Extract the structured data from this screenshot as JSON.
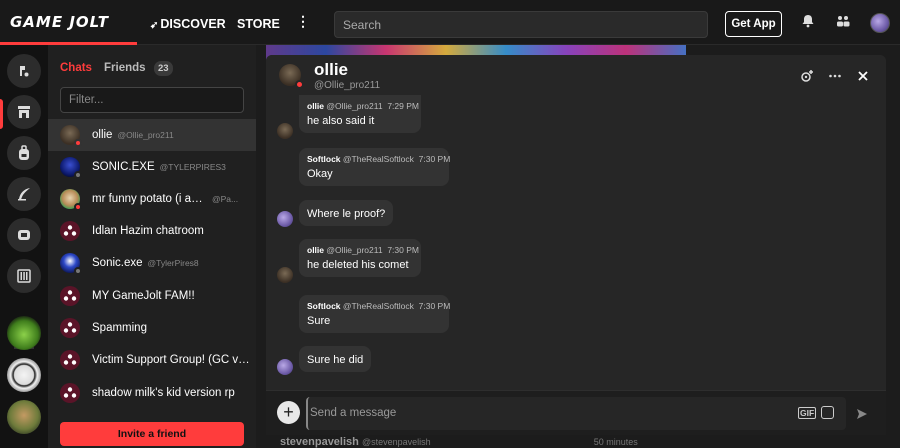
{
  "brand": {
    "name": "GAME JOLT",
    "accent": "#ff3c3c"
  },
  "nav": {
    "discover": "DISCOVER",
    "store": "STORE",
    "more": "more-icon"
  },
  "search": {
    "placeholder": "Search"
  },
  "header_actions": {
    "get_app": "Get App"
  },
  "sidebar_tabs": {
    "chats": "Chats",
    "friends": "Friends",
    "friend_count": "23"
  },
  "filter": {
    "placeholder": "Filter..."
  },
  "chats": [
    {
      "name": "ollie",
      "handle": "@Ollie_pro211"
    },
    {
      "name": "SONIC.EXE",
      "handle": "@TYLERPIRES3"
    },
    {
      "name": "mr funny potato (i am a f...",
      "handle": "@Pa..."
    },
    {
      "name": "Idlan Hazim chatroom",
      "handle": ""
    },
    {
      "name": "Sonic.exe",
      "handle": "@TylerPires8"
    },
    {
      "name": "MY GameJolt FAM!!",
      "handle": ""
    },
    {
      "name": "Spamming",
      "handle": ""
    },
    {
      "name": "Victim Support Group! (GC ver...",
      "handle": ""
    },
    {
      "name": "shadow milk's kid version rp",
      "handle": ""
    }
  ],
  "invite": {
    "label": "Invite a friend"
  },
  "room": {
    "name": "ollie",
    "handle": "@Ollie_pro211"
  },
  "messages": [
    {
      "user": "ollie",
      "handle": "@Ollie_pro211",
      "time": "7:29 PM",
      "text": "he also said it"
    },
    {
      "user": "Softlock",
      "handle": "@TheRealSoftlock",
      "time": "7:30 PM",
      "text": "Okay"
    },
    {
      "user": "",
      "handle": "",
      "time": "",
      "text": "Where le proof?"
    },
    {
      "user": "ollie",
      "handle": "@Ollie_pro211",
      "time": "7:30 PM",
      "text": "he deleted his comet"
    },
    {
      "user": "Softlock",
      "handle": "@TheRealSoftlock",
      "time": "7:30 PM",
      "text": "Sure"
    },
    {
      "user": "",
      "handle": "",
      "time": "",
      "text": "Sure he did"
    }
  ],
  "composer": {
    "placeholder": "Send a message",
    "gif": "GIF"
  },
  "background_feed": {
    "user": "stevenpavelish",
    "handle": "@stevenpavelish",
    "time": "50 minutes"
  }
}
